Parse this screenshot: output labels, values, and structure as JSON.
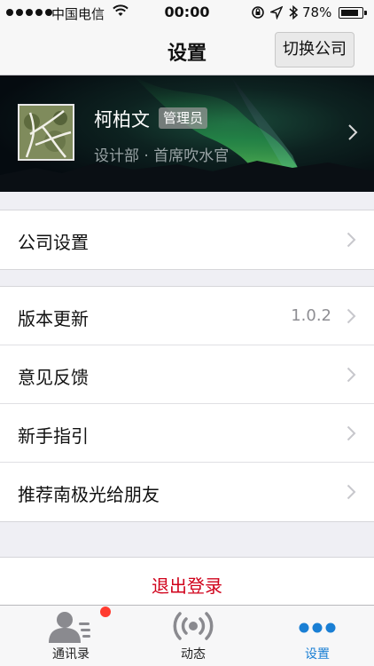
{
  "status_bar": {
    "carrier": "中国电信",
    "time": "00:00",
    "battery": "78%"
  },
  "nav": {
    "title": "设置",
    "switch_company": "切换公司"
  },
  "profile": {
    "name": "柯柏文",
    "role": "管理员",
    "department": "设计部 · 首席吹水官"
  },
  "groups": [
    {
      "items": [
        {
          "label": "公司设置",
          "value": ""
        }
      ]
    },
    {
      "items": [
        {
          "label": "版本更新",
          "value": "1.0.2"
        },
        {
          "label": "意见反馈",
          "value": ""
        },
        {
          "label": "新手指引",
          "value": ""
        },
        {
          "label": "推荐南极光给朋友",
          "value": ""
        }
      ]
    }
  ],
  "logout": {
    "label": "退出登录"
  },
  "tabs": [
    {
      "label": "通讯录",
      "icon": "contacts-icon",
      "active": false,
      "badge": true
    },
    {
      "label": "动态",
      "icon": "broadcast-icon",
      "active": false,
      "badge": false
    },
    {
      "label": "设置",
      "icon": "more-dots-icon",
      "active": true,
      "badge": false
    }
  ],
  "colors": {
    "accent": "#1a7fd4",
    "logout": "#d0021b",
    "badge": "#ff3b30"
  }
}
